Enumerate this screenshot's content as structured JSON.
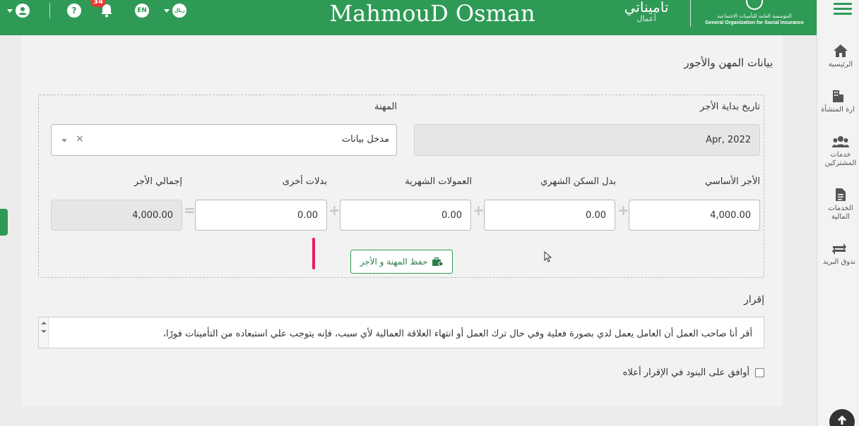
{
  "header": {
    "title": "MahmouD Osman",
    "notification_count": "34",
    "language": "EN",
    "currency": "ريال",
    "brand_ar": "تاميناتي",
    "brand_sub": "أعمال",
    "gosi_ar": "المؤسسة العامة للتأمينات الاجتماعية",
    "gosi_en": "General Organization for Social Insurance"
  },
  "sidebar": {
    "items": [
      {
        "label": "الرئيسية",
        "icon": "home-icon"
      },
      {
        "label": "ارة المنشأة",
        "icon": "building-icon"
      },
      {
        "label": "خدمات المشتركين",
        "icon": "users-icon"
      },
      {
        "label": "الخدمات المالية",
        "icon": "document-icon"
      },
      {
        "label": "ندوق البريد",
        "icon": "exchange-icon"
      }
    ]
  },
  "form": {
    "section_title": "بيانات المهن والأجور",
    "wage_start_label": "تاريخ بداية الأجر",
    "wage_start_value": "Apr, 2022",
    "occupation_label": "المهنة",
    "occupation_value": "مدخل بيانات",
    "basic_wage_label": "الأجر الأساسي",
    "basic_wage_value": "4,000.00",
    "housing_label": "بدل السكن الشهري",
    "housing_value": "0.00",
    "commissions_label": "العمولات الشهرية",
    "commissions_value": "0.00",
    "other_label": "بدلات أخرى",
    "other_value": "0.00",
    "total_label": "إجمالي الأجر",
    "total_value": "4,000.00",
    "save_button": "حفظ المهنة و الأجر"
  },
  "declaration": {
    "title": "إقرار",
    "line1": "أقر أنا صاحب العمل أن العامل يعمل لدي بصورة فعلية وفي حال ترك العمل أو انتهاء العلاقة العمالية لأي سبب، فإنه يتوجب علي استبعاده من التأمينات فورًا،",
    "agree_label": "أوافق على البنود في الإقرار أعلاه"
  },
  "colors": {
    "primary": "#2e9a56",
    "accent": "#e91e5b"
  }
}
